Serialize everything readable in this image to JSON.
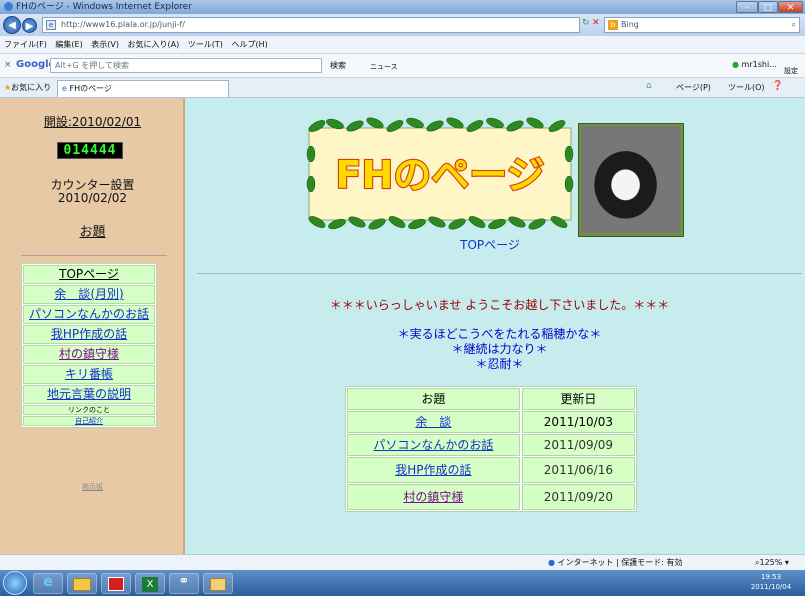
{
  "browser": {
    "window_title": "FHのページ - Windows Internet Explorer",
    "address": "http://www16.plala.or.jp/junji-f/",
    "search_engine": "Bing",
    "menu": [
      "ファイル(F)",
      "編集(E)",
      "表示(V)",
      "お気に入り(A)",
      "ツール(T)",
      "ヘルプ(H)"
    ],
    "google_label": "Google",
    "google_placeholder": "Alt+G を押して検索",
    "google_search_btn": "検索",
    "news_btn": "ニュース",
    "account": "mr1shi...",
    "settings": "設定",
    "favorites": "お気に入り",
    "tab_title": "FHのページ",
    "cmd_page": "ページ(P)",
    "cmd_tools": "ツール(O)",
    "status_zone": "インターネット | 保護モード: 有効",
    "zoom": "125%"
  },
  "sidebar": {
    "opened": "開設:2010/02/01",
    "counter": "014444",
    "counter_set_label": "カウンター設置",
    "counter_set_date": "2010/02/02",
    "topic_heading": "お題",
    "nav": [
      {
        "label": "TOPページ",
        "style": "plain"
      },
      {
        "label": "余　談(月別)",
        "style": "link"
      },
      {
        "label": "パソコンなんかのお話",
        "style": "link"
      },
      {
        "label": "我HP作成の話",
        "style": "link"
      },
      {
        "label": "村の鎮守様",
        "style": "visited"
      },
      {
        "label": "キリ番帳",
        "style": "link"
      },
      {
        "label": "地元言葉の説明",
        "style": "link"
      },
      {
        "label": "リンクのこと",
        "style": "small"
      },
      {
        "label": "自己紹介",
        "style": "small-link"
      }
    ],
    "bbs": "掲示板"
  },
  "main": {
    "banner_text": "FHのページ",
    "top_link": "TOPページ",
    "welcome": "＊＊＊いらっしゃいませ ようこそお越し下さいました。＊＊＊",
    "motto1": "＊実るほどこうべをたれる稲穂かな＊",
    "motto2": "＊継続は力なり＊",
    "motto3": "＊忍耐＊",
    "table_headers": [
      "お題",
      "更新日"
    ],
    "table_rows": [
      {
        "topic": "余　談",
        "date": "2011/10/03"
      },
      {
        "topic": "パソコンなんかのお話",
        "date": "2011/09/09"
      },
      {
        "topic": "我HP作成の話",
        "date": "2011/06/16"
      },
      {
        "topic": "村の鎮守様",
        "date": "2011/09/20"
      }
    ]
  },
  "taskbar": {
    "time": "19:53",
    "date": "2011/10/04"
  },
  "colors": {
    "content_bg": "#c6ecee",
    "sidebar_bg": "#e8c9a6",
    "cell_bg": "#d6ffc6",
    "welcome_color": "#a00000",
    "motto_color": "#0000c8"
  }
}
